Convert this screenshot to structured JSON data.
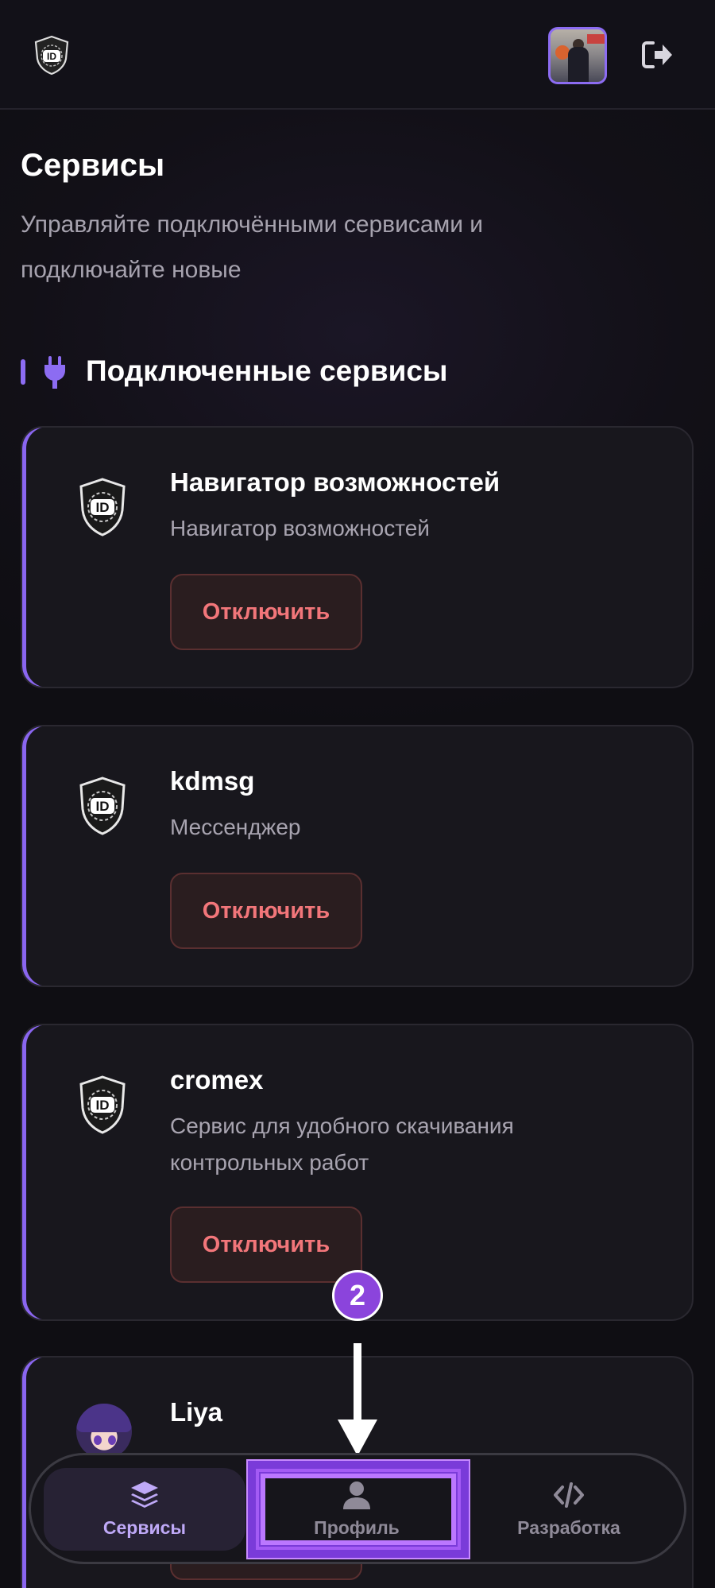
{
  "header": {
    "logo_icon": "id-shield-logo-icon",
    "avatar_icon": "user-avatar-icon",
    "logout_icon": "logout-icon"
  },
  "page": {
    "title": "Сервисы",
    "subtitle": "Управляйте подключёнными сервисами и подключайте новые"
  },
  "section": {
    "icon": "plug-icon",
    "title": "Подключенные сервисы"
  },
  "services": [
    {
      "name": "Навигатор возможностей",
      "description": "Навигатор возможностей",
      "button": "Отключить",
      "icon": "id-shield-icon"
    },
    {
      "name": "kdmsg",
      "description": "Мессенджер",
      "button": "Отключить",
      "icon": "id-shield-icon"
    },
    {
      "name": "cromex",
      "description": "Сервис для удобного скачивания контрольных работ",
      "button": "Отключить",
      "icon": "id-shield-icon"
    },
    {
      "name": "Liya",
      "description": "",
      "button": "Отключить",
      "icon": "liya-avatar-icon"
    }
  ],
  "bottom_nav": [
    {
      "label": "Сервисы",
      "icon": "layers-icon",
      "active": true
    },
    {
      "label": "Профиль",
      "icon": "user-icon",
      "active": false
    },
    {
      "label": "Разработка",
      "icon": "code-icon",
      "active": false
    }
  ],
  "annotation": {
    "step": "2"
  },
  "colors": {
    "accent": "#8c6cf2",
    "danger": "#f2767a",
    "background": "#121017"
  }
}
